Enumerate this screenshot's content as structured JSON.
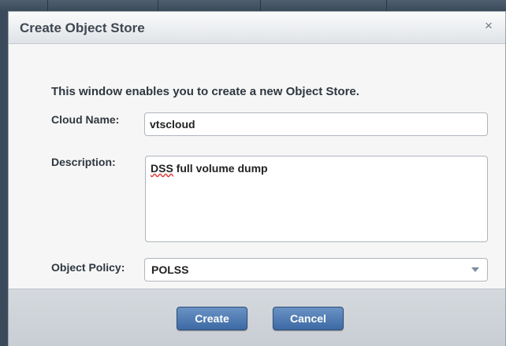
{
  "dialog": {
    "title": "Create Object Store",
    "close_glyph": "×",
    "intro_text": "This window enables you to create a new Object Store."
  },
  "form": {
    "cloud_name": {
      "label": "Cloud Name:",
      "value": "vtscloud"
    },
    "description": {
      "label": "Description:",
      "misspelled_word": "DSS",
      "rest_text": " full volume dump"
    },
    "object_policy": {
      "label": "Object Policy:",
      "selected": "POLSS"
    }
  },
  "buttons": {
    "create": "Create",
    "cancel": "Cancel"
  },
  "colors": {
    "button_primary": "#4a76ae",
    "footer_bg": "#cfd4d9",
    "text": "#2e3740"
  },
  "icons": {
    "close": "close-icon",
    "dropdown": "chevron-down-icon"
  }
}
